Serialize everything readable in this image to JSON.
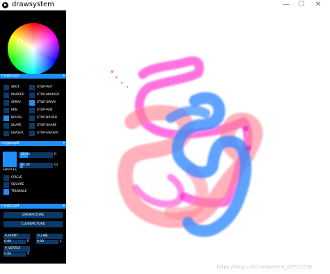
{
  "window": {
    "title": "drawsystem",
    "minimize": "—",
    "maximize": "☐",
    "close": "✕"
  },
  "colors": {
    "accent": "#1e8fff",
    "control_bg": "#0c3a66",
    "panel_bg": "#000000",
    "pink": "#ff7f8f",
    "magenta": "#ff00c8",
    "blue": "#3a8cff"
  },
  "icons": {
    "app": "play-circle-icon"
  },
  "group1": {
    "name": "mygroup2",
    "toggle": "▾"
  },
  "tools": [
    {
      "label": "SPOT",
      "active": false
    },
    {
      "label": "STOP-POT",
      "active": false
    },
    {
      "label": "MARKER",
      "active": false
    },
    {
      "label": "STOP-MARKER",
      "active": false
    },
    {
      "label": "SPRAY",
      "active": false
    },
    {
      "label": "STOP-SPRAY",
      "active": true
    },
    {
      "label": "PEN",
      "active": false
    },
    {
      "label": "STOP-PEN",
      "active": false
    },
    {
      "label": "BRUSH",
      "active": true
    },
    {
      "label": "STOP-BRUSH",
      "active": false
    },
    {
      "label": "SHAPE",
      "active": false
    },
    {
      "label": "STOP-SHAPE",
      "active": false
    },
    {
      "label": "ERASER",
      "active": false
    },
    {
      "label": "STOP-ERASER",
      "active": false
    }
  ],
  "group2": {
    "name": "mygroup3",
    "toggle": "▾"
  },
  "sliders": [
    {
      "value": "20.00",
      "label": "R",
      "fraction": 0.25
    },
    {
      "value": "10.00",
      "label": "GI",
      "fraction": 0.1
    }
  ],
  "shuffle_label": "SHUFFLE",
  "shapes": [
    {
      "label": "CIRCLE",
      "active": false
    },
    {
      "label": "SQUARE",
      "active": false
    },
    {
      "label": "TRIANGLE",
      "active": true
    }
  ],
  "group3": {
    "name": "mygroup4",
    "toggle": "▾"
  },
  "buttons": {
    "open": "OPENPICTURE",
    "close": "CLOSEPICTURE"
  },
  "params": {
    "point": {
      "label": "P_POINT",
      "value": "0.00",
      "suffix": "R"
    },
    "line": {
      "label": "P_LINE",
      "value": "0.00",
      "suffix": "L"
    },
    "vertex": {
      "label": "P_VERTEX",
      "value": "0.00",
      "suffix": "S"
    }
  },
  "watermark": "https://blog.csdn.net/weixin_43701156"
}
